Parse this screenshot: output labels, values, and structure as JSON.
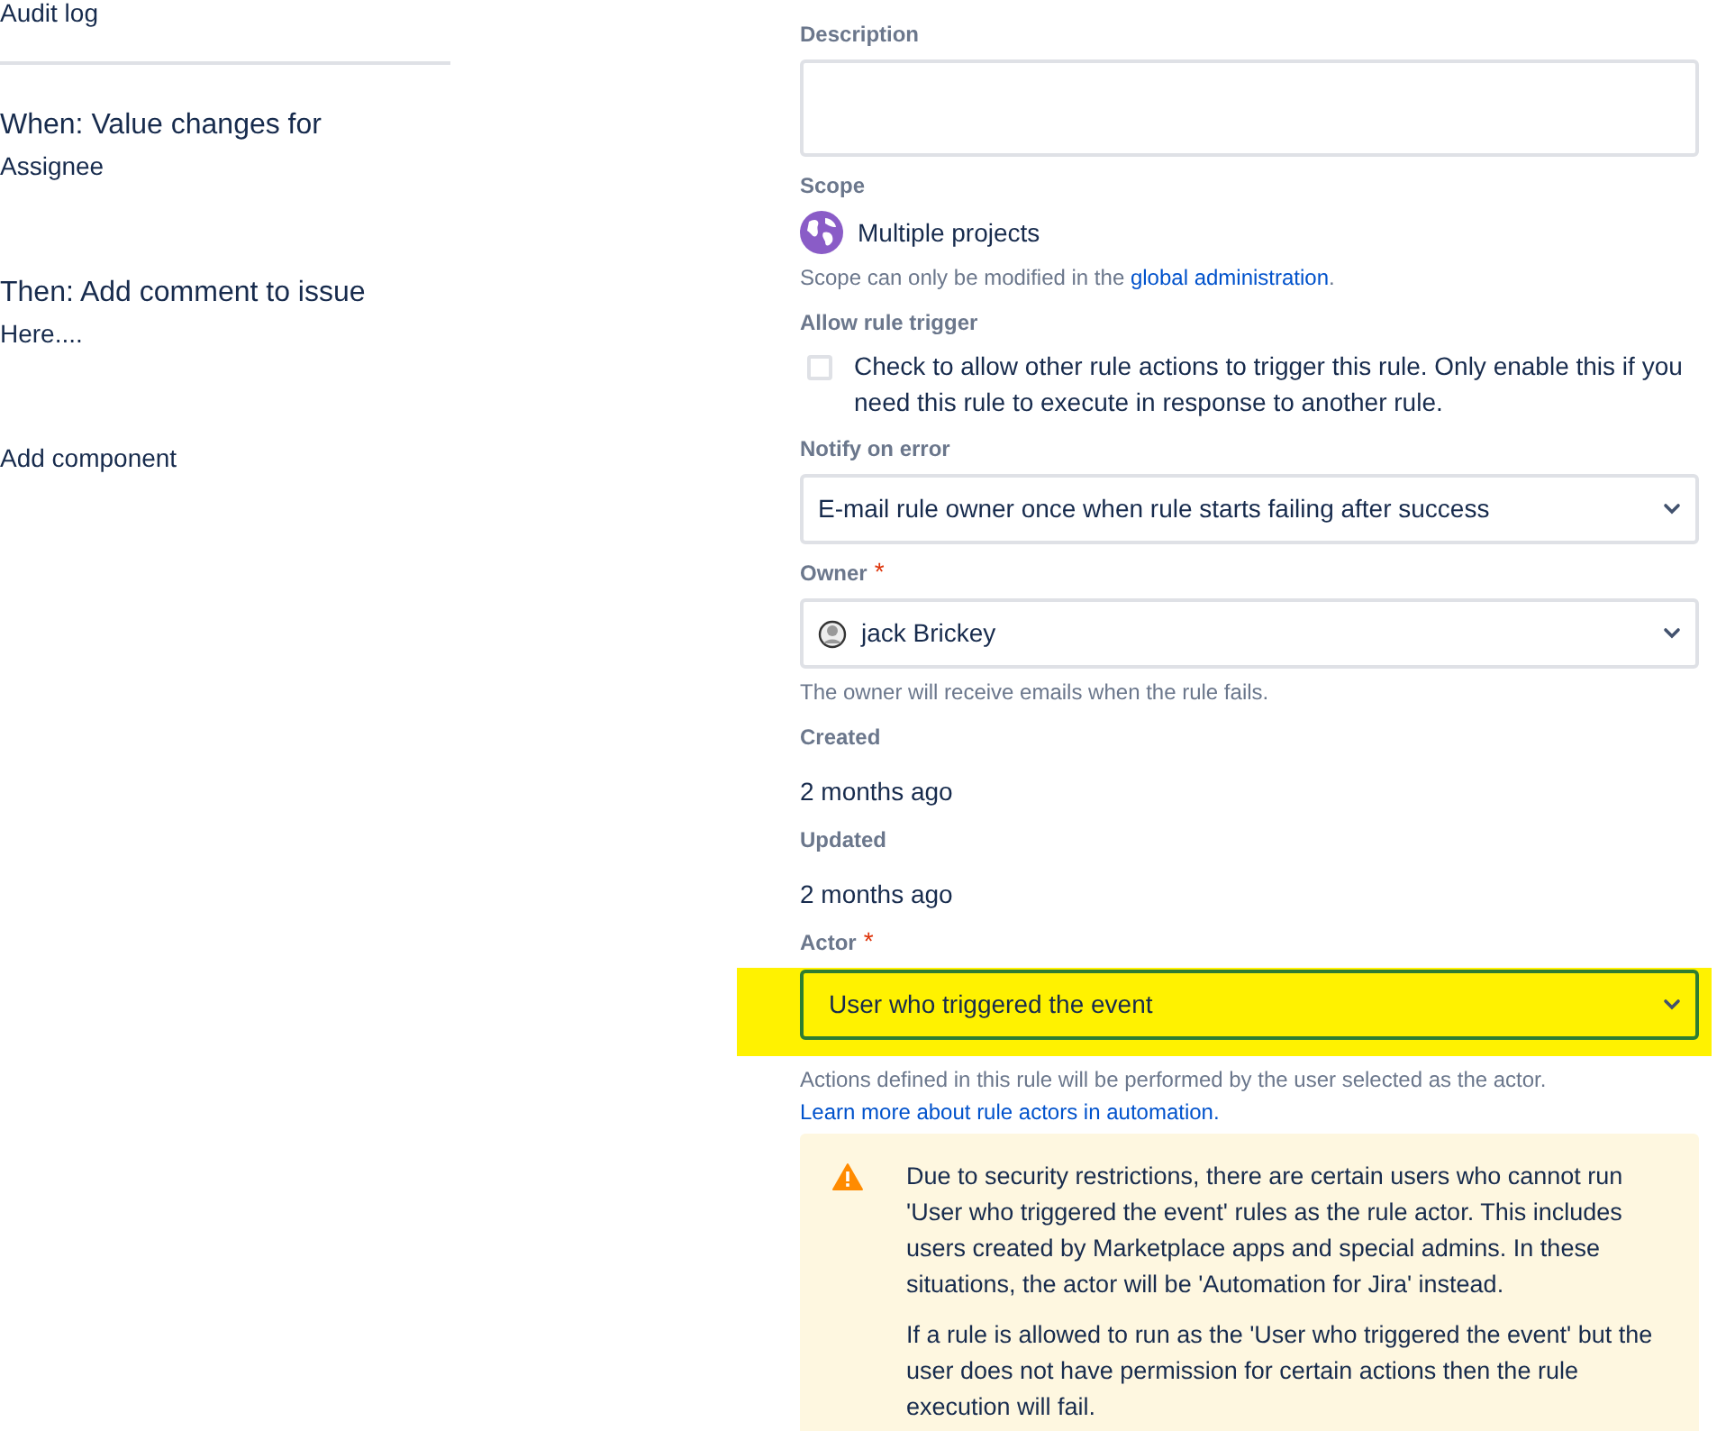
{
  "sidebar": {
    "items": [
      {
        "kind": "link",
        "title": "Audit log"
      },
      {
        "kind": "divider"
      },
      {
        "kind": "step",
        "title": "When: Value changes for",
        "detail": "Assignee"
      },
      {
        "kind": "step",
        "title": "Then: Add comment to issue",
        "detail": "Here...."
      },
      {
        "kind": "link",
        "title": "Add component"
      }
    ]
  },
  "fields": [
    {
      "kind": "textarea",
      "label": "Description"
    },
    {
      "kind": "scope",
      "label": "Scope",
      "value": "Multiple projects",
      "hint": "Scope can only be modified in the ",
      "hint_link": "global administration",
      "hint_end": "."
    },
    {
      "kind": "checkbox",
      "label": "Allow rule trigger",
      "checked": false,
      "text": "Check to allow other rule actions to trigger this rule. Only enable this if you need this rule to execute in response to another rule."
    },
    {
      "kind": "select",
      "label": "Notify on error",
      "value": "E-mail rule owner once when rule starts failing after success",
      "highlighted": false
    },
    {
      "kind": "user",
      "label": "Owner",
      "required_mark": "*",
      "value": "jack Brickey",
      "hint": "The owner will receive emails when the rule fails."
    },
    {
      "kind": "static",
      "label": "Created",
      "value": "2 months ago"
    },
    {
      "kind": "static",
      "label": "Updated",
      "value": "2 months ago"
    },
    {
      "kind": "select",
      "label": "Actor",
      "required_mark": "*",
      "value": "User who triggered the event",
      "highlighted": true,
      "hint": "Actions defined in this rule will be performed by the user selected as the actor. ",
      "hint_link": "Learn more about rule actors in automation."
    }
  ],
  "warning": {
    "paragraphs": [
      "Due to security restrictions, there are certain users who cannot run 'User who triggered the event' rules as the rule actor. This includes users created by Marketplace apps and special admins. In these situations, the actor will be 'Automation for Jira' instead.",
      "If a rule is allowed to run as the 'User who triggered the event' but the user does not have permission for certain actions then the rule execution will fail."
    ]
  }
}
